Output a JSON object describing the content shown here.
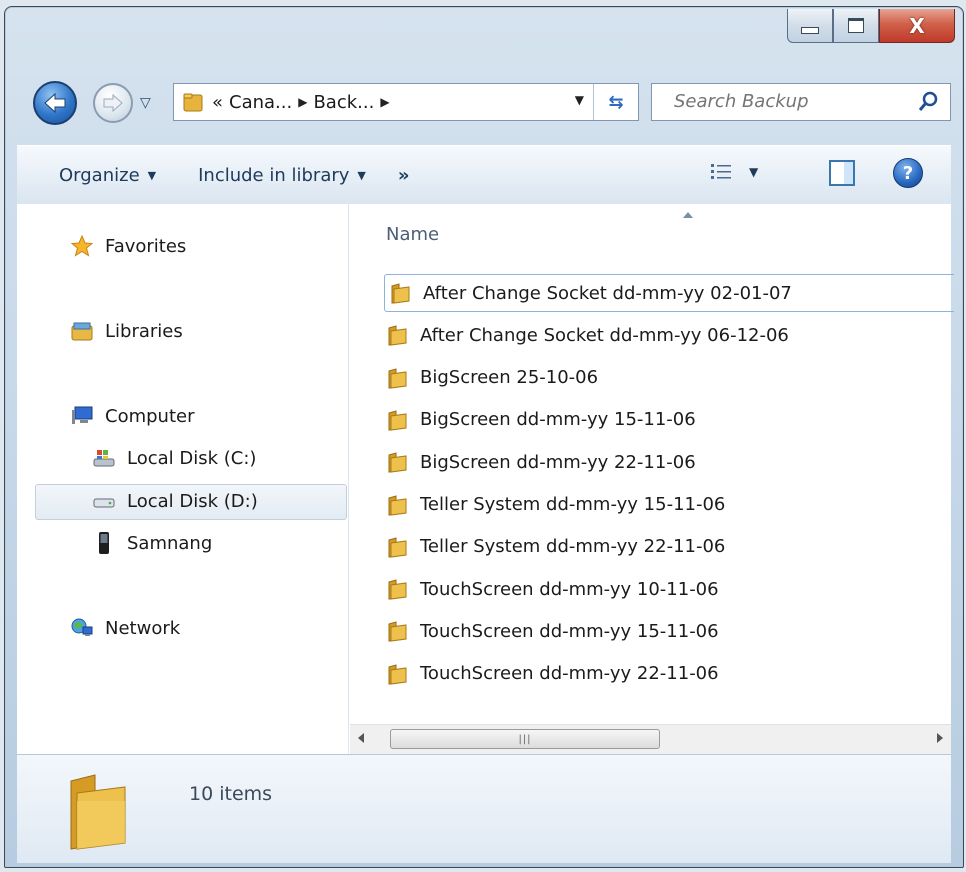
{
  "window": {
    "caption_buttons": {
      "min_icon": "minimize-icon",
      "max_icon": "maximize-icon",
      "close_label": "X"
    }
  },
  "nav": {
    "breadcrumb_prefix": "«",
    "breadcrumbs": [
      "Cana...",
      "Back..."
    ],
    "search_placeholder": "Search Backup"
  },
  "commandbar": {
    "organize": "Organize",
    "include": "Include in library",
    "more": "»"
  },
  "sidebar": {
    "items": [
      {
        "label": "Favorites",
        "icon": "star-icon"
      },
      {
        "label": "Libraries",
        "icon": "libraries-icon"
      },
      {
        "label": "Computer",
        "icon": "computer-icon"
      },
      {
        "label": "Local Disk (C:)",
        "icon": "system-drive-icon"
      },
      {
        "label": "Local Disk (D:)",
        "icon": "drive-icon"
      },
      {
        "label": "Samnang",
        "icon": "phone-icon"
      },
      {
        "label": "Network",
        "icon": "network-icon"
      }
    ]
  },
  "files": {
    "column_name": "Name",
    "rows": [
      "After Change Socket dd-mm-yy 02-01-07",
      "After Change Socket dd-mm-yy 06-12-06",
      "BigScreen 25-10-06",
      "BigScreen dd-mm-yy 15-11-06",
      "BigScreen dd-mm-yy 22-11-06",
      "Teller System dd-mm-yy 15-11-06",
      "Teller System dd-mm-yy 22-11-06",
      "TouchScreen dd-mm-yy 10-11-06",
      "TouchScreen dd-mm-yy 15-11-06",
      "TouchScreen dd-mm-yy 22-11-06"
    ]
  },
  "details": {
    "count": "10 items"
  },
  "colors": {
    "accent": "#2f75c9",
    "folder": "#e8b33a",
    "close": "#c0392b"
  }
}
